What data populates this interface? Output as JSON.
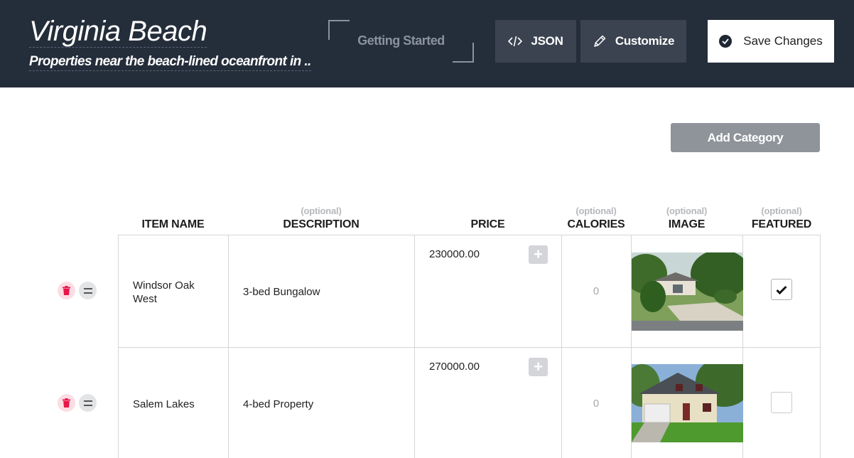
{
  "header": {
    "title": "Virginia Beach",
    "subtitle": "Properties near the beach-lined oceanfront in ...",
    "getting_started": "Getting Started",
    "json_label": "JSON",
    "customize_label": "Customize",
    "save_label": "Save Changes"
  },
  "toolbar": {
    "add_category_label": "Add Category"
  },
  "table": {
    "optional_label": "(optional)",
    "columns": {
      "item_name": "ITEM NAME",
      "description": "DESCRIPTION",
      "price": "PRICE",
      "calories": "CALORIES",
      "image": "IMAGE",
      "featured": "FEATURED"
    },
    "rows": [
      {
        "name": "Windsor Oak West",
        "description": "3-bed Bungalow",
        "price": "230000.00",
        "calories": "0",
        "featured": true,
        "image_icon": "house-photo-icon"
      },
      {
        "name": "Salem Lakes",
        "description": "4-bed Property",
        "price": "270000.00",
        "calories": "0",
        "featured": false,
        "image_icon": "house-photo-icon"
      }
    ]
  },
  "colors": {
    "header_bg": "#242d3a",
    "header_button_bg": "#3b4350",
    "add_category_bg": "#8f949b",
    "trash_bg": "#fbdde3",
    "trash_icon": "#e8174a"
  }
}
